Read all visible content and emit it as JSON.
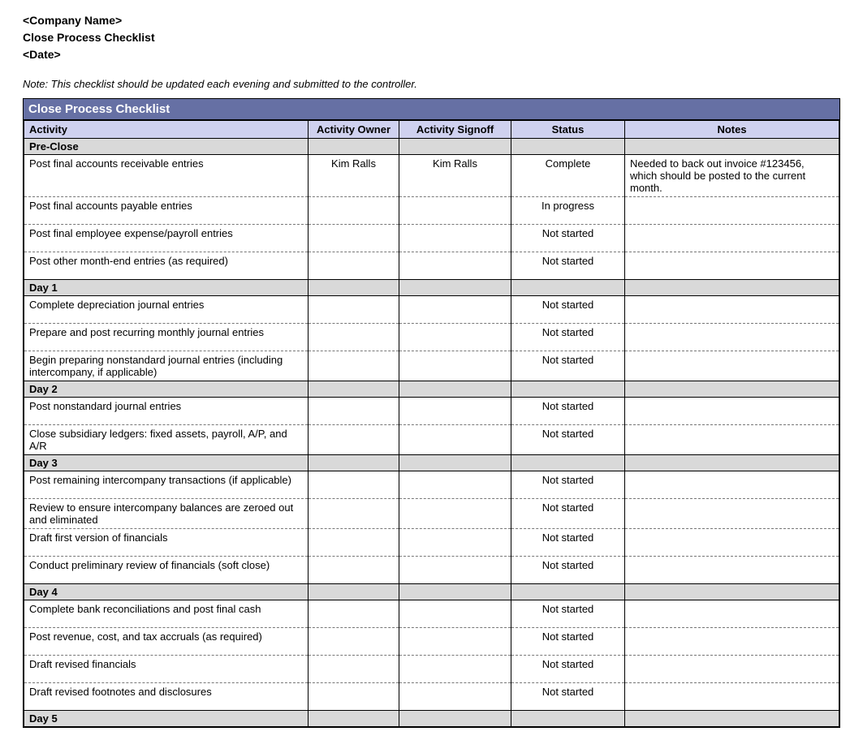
{
  "header": {
    "company": "<Company Name>",
    "title": "Close Process Checklist",
    "date": "<Date>"
  },
  "note": "Note: This checklist should be updated each evening and submitted to the controller.",
  "tableTitle": "Close Process Checklist",
  "columns": {
    "activity": "Activity",
    "owner": "Activity Owner",
    "signoff": "Activity Signoff",
    "status": "Status",
    "notes": "Notes"
  },
  "sections": [
    {
      "label": "Pre-Close",
      "rows": [
        {
          "activity": "Post final accounts receivable entries",
          "owner": "Kim Ralls",
          "signoff": "Kim Ralls",
          "status": "Complete",
          "notes": "Needed to back out invoice #123456, which should be posted to the current month."
        },
        {
          "activity": "Post final accounts payable entries",
          "owner": "",
          "signoff": "",
          "status": "In progress",
          "notes": ""
        },
        {
          "activity": "Post final employee expense/payroll entries",
          "owner": "",
          "signoff": "",
          "status": "Not started",
          "notes": ""
        },
        {
          "activity": "Post other month-end entries (as required)",
          "owner": "",
          "signoff": "",
          "status": "Not started",
          "notes": ""
        }
      ]
    },
    {
      "label": "Day 1",
      "rows": [
        {
          "activity": "Complete depreciation journal entries",
          "owner": "",
          "signoff": "",
          "status": "Not started",
          "notes": ""
        },
        {
          "activity": "Prepare and post recurring monthly journal entries",
          "owner": "",
          "signoff": "",
          "status": "Not started",
          "notes": ""
        },
        {
          "activity": "Begin preparing nonstandard journal entries (including intercompany, if applicable)",
          "owner": "",
          "signoff": "",
          "status": "Not started",
          "notes": ""
        }
      ]
    },
    {
      "label": "Day 2",
      "rows": [
        {
          "activity": "Post nonstandard journal entries",
          "owner": "",
          "signoff": "",
          "status": "Not started",
          "notes": ""
        },
        {
          "activity": "Close subsidiary ledgers: fixed assets, payroll, A/P, and A/R",
          "owner": "",
          "signoff": "",
          "status": "Not started",
          "notes": ""
        }
      ]
    },
    {
      "label": "Day 3",
      "rows": [
        {
          "activity": "Post remaining intercompany transactions (if applicable)",
          "owner": "",
          "signoff": "",
          "status": "Not started",
          "notes": ""
        },
        {
          "activity": "Review to ensure intercompany balances are zeroed out and eliminated",
          "owner": "",
          "signoff": "",
          "status": "Not started",
          "notes": ""
        },
        {
          "activity": "Draft first version of financials",
          "owner": "",
          "signoff": "",
          "status": "Not started",
          "notes": ""
        },
        {
          "activity": "Conduct preliminary review of financials (soft close)",
          "owner": "",
          "signoff": "",
          "status": "Not started",
          "notes": ""
        }
      ]
    },
    {
      "label": "Day 4",
      "rows": [
        {
          "activity": "Complete bank reconciliations and post final cash",
          "owner": "",
          "signoff": "",
          "status": "Not started",
          "notes": ""
        },
        {
          "activity": "Post revenue, cost, and tax accruals (as required)",
          "owner": "",
          "signoff": "",
          "status": "Not started",
          "notes": ""
        },
        {
          "activity": "Draft revised financials",
          "owner": "",
          "signoff": "",
          "status": "Not started",
          "notes": ""
        },
        {
          "activity": "Draft revised footnotes and disclosures",
          "owner": "",
          "signoff": "",
          "status": "Not started",
          "notes": ""
        }
      ]
    },
    {
      "label": "Day 5",
      "rows": []
    }
  ]
}
